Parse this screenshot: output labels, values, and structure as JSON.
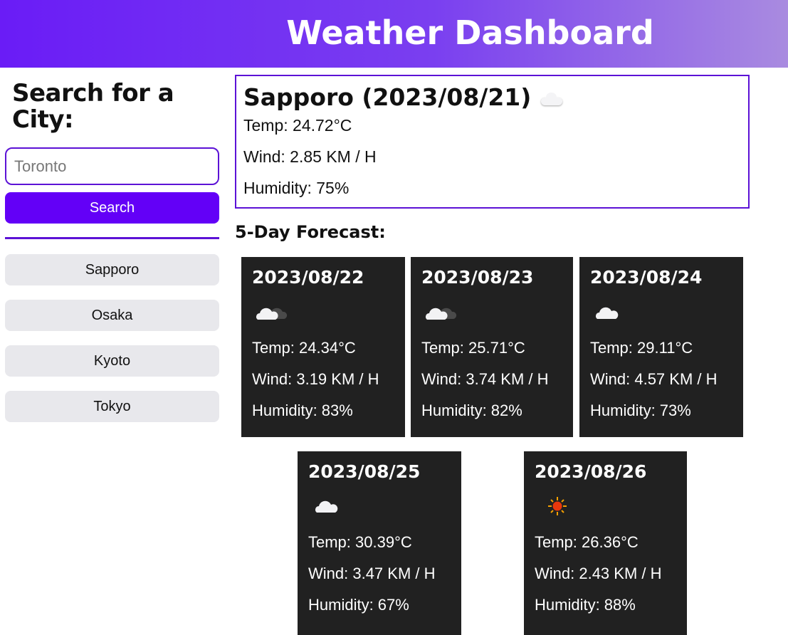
{
  "header": {
    "title": "Weather Dashboard"
  },
  "sidebar": {
    "title": "Search for a City:",
    "input_placeholder": "Toronto",
    "search_label": "Search",
    "history": [
      "Sapporo",
      "Osaka",
      "Kyoto",
      "Tokyo"
    ]
  },
  "current": {
    "title": "Sapporo (2023/08/21)",
    "icon": "cloud-icon",
    "temp": "Temp: 24.72°C",
    "wind": "Wind: 2.85 KM / H",
    "humidity": "Humidity: 75%"
  },
  "forecast": {
    "title": "5-Day Forecast:",
    "days": [
      {
        "date": "2023/08/22",
        "icon": "partly-cloudy-icon",
        "temp": "Temp: 24.34°C",
        "wind": "Wind: 3.19 KM / H",
        "humidity": "Humidity: 83%"
      },
      {
        "date": "2023/08/23",
        "icon": "partly-cloudy-icon",
        "temp": "Temp: 25.71°C",
        "wind": "Wind: 3.74 KM / H",
        "humidity": "Humidity: 82%"
      },
      {
        "date": "2023/08/24",
        "icon": "cloud-icon",
        "temp": "Temp: 29.11°C",
        "wind": "Wind: 4.57 KM / H",
        "humidity": "Humidity: 73%"
      },
      {
        "date": "2023/08/25",
        "icon": "cloud-icon",
        "temp": "Temp: 30.39°C",
        "wind": "Wind: 3.47 KM / H",
        "humidity": "Humidity: 67%"
      },
      {
        "date": "2023/08/26",
        "icon": "sun-icon",
        "temp": "Temp: 26.36°C",
        "wind": "Wind: 2.43 KM / H",
        "humidity": "Humidity: 88%"
      }
    ]
  },
  "colors": {
    "accent": "#6300f7",
    "border": "#5c12d6",
    "card_bg": "#212121",
    "history_bg": "#e8e8ec"
  }
}
